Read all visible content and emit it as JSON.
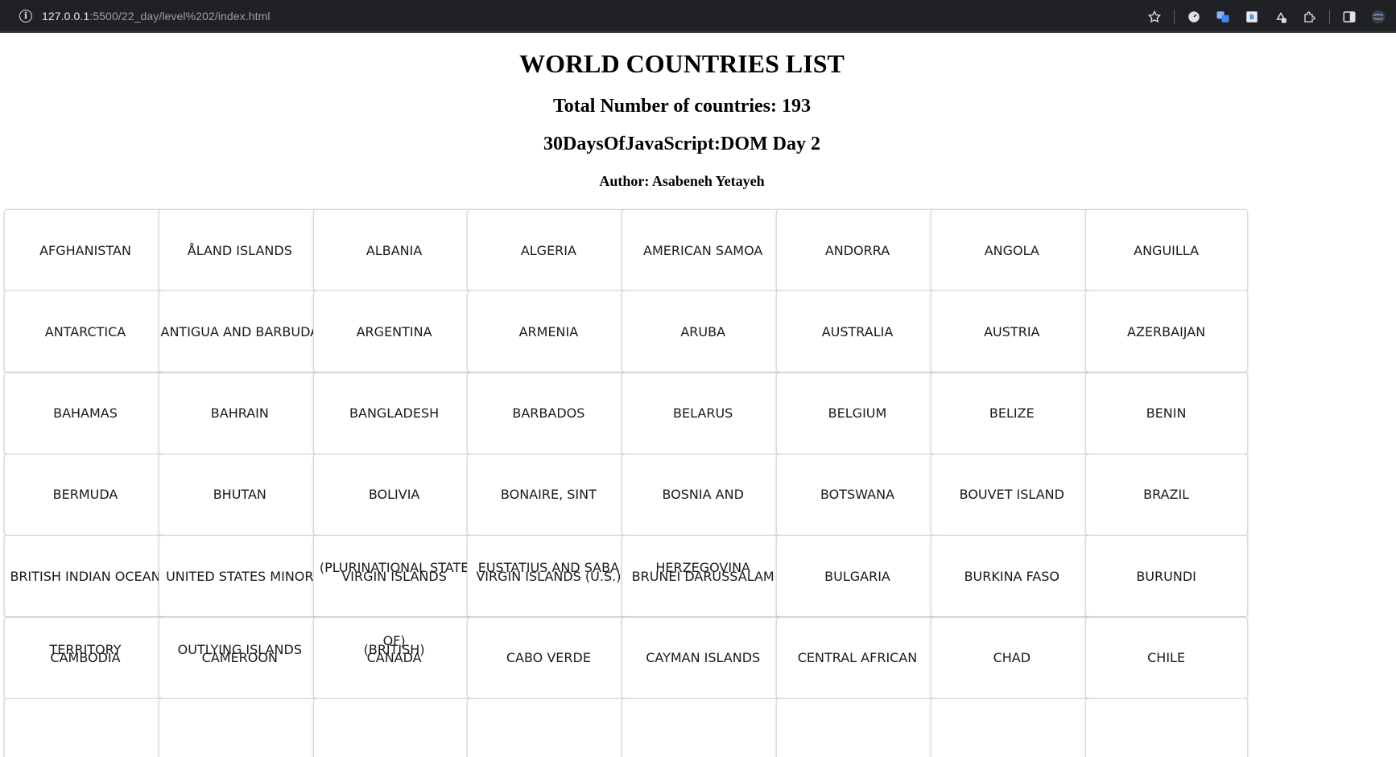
{
  "browser": {
    "url_host": "127.0.0.1",
    "url_path": ":5500/22_day/level%202/index.html"
  },
  "header": {
    "title": "WORLD COUNTRIES LIST",
    "total": "Total Number of countries: 193",
    "subtitle": "30DaysOfJavaScript:DOM Day 2",
    "author": "Author: Asabeneh Yetayeh"
  },
  "countries": [
    "AFGHANISTAN",
    "ÅLAND ISLANDS",
    "ALBANIA",
    "ALGERIA",
    "AMERICAN SAMOA",
    "ANDORRA",
    "ANGOLA",
    "ANGUILLA",
    "ANTARCTICA",
    "ANTIGUA AND BARBUDA",
    "ARGENTINA",
    "ARMENIA",
    "ARUBA",
    "AUSTRALIA",
    "AUSTRIA",
    "AZERBAIJAN",
    "BAHAMAS",
    "BAHRAIN",
    "BANGLADESH",
    "BARBADOS",
    "BELARUS",
    "BELGIUM",
    "BELIZE",
    "BENIN",
    "BERMUDA",
    "BHUTAN",
    "BOLIVIA",
    "BONAIRE, SINT",
    "BOSNIA AND",
    "BOTSWANA",
    "BOUVET ISLAND",
    "BRAZIL",
    "BRITISH INDIAN OCEAN",
    "UNITED STATES MINOR",
    "VIRGIN ISLANDS",
    "VIRGIN ISLANDS (U.S.)",
    "BRUNEI DARUSSALAM",
    "BULGARIA",
    "BURKINA FASO",
    "BURUNDI",
    "CAMBODIA",
    "CAMEROON",
    "CANADA",
    "CABO VERDE",
    "CAYMAN ISLANDS",
    "CENTRAL AFRICAN",
    "CHAD",
    "CHILE"
  ],
  "overflow_text": {
    "row5_col3": "(PLURINATIONAL STATE",
    "row5_col4": "EUSTATIUS AND SABA",
    "row5_col5": "HERZEGOVINA",
    "row6_col1": "TERRITORY",
    "row6_col2": "OUTLYING ISLANDS",
    "row6_col3a": "OF)",
    "row6_col3b": "(BRITISH)"
  }
}
